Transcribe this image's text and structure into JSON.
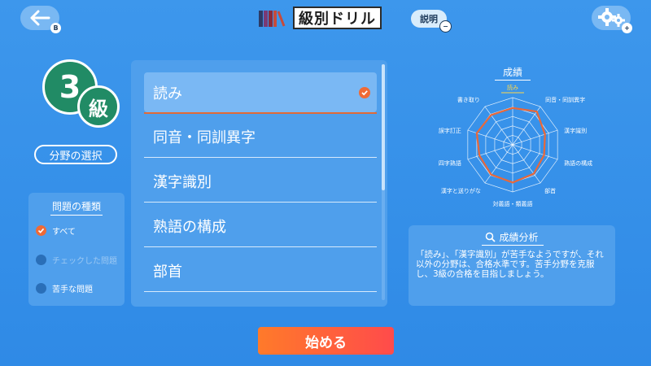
{
  "header": {
    "back_badge": "B",
    "title": "級別ドリル",
    "help_label": "説明",
    "help_badge": "−",
    "settings_badge": "+"
  },
  "level": {
    "number": "3",
    "unit": "級"
  },
  "category_button": "分野の選択",
  "question_types": {
    "title": "問題の種類",
    "options": [
      {
        "label": "すべて",
        "selected": true
      },
      {
        "label": "チェックした問題",
        "selected": false
      },
      {
        "label": "苦手な問題",
        "selected": false
      }
    ]
  },
  "categories": [
    {
      "label": "読み",
      "selected": true
    },
    {
      "label": "同音・同訓異字",
      "selected": false
    },
    {
      "label": "漢字識別",
      "selected": false
    },
    {
      "label": "熟語の構成",
      "selected": false
    },
    {
      "label": "部首",
      "selected": false
    }
  ],
  "radar": {
    "title": "成績",
    "highlight_label": "読み",
    "labels": [
      "読み",
      "同音・同訓異字",
      "漢字識別",
      "熟語の構成",
      "部首",
      "対義語・類義語",
      "漢字と送りがな",
      "四字熟語",
      "誤字訂正",
      "書き取り"
    ],
    "scores": [
      0.78,
      0.87,
      0.72,
      0.7,
      0.76,
      0.8,
      0.78,
      0.74,
      0.8,
      0.78
    ],
    "colors": {
      "score": "#e8683a",
      "grid": "#ffffff",
      "highlight": "#ffd84a"
    }
  },
  "analysis": {
    "title": "成績分析",
    "text": "「読み」、「漢字識別」が苦手なようですが、それ以外の分野は、合格水準です。苦手分野を克服し、3級の合格を目指しましょう。"
  },
  "start_button": "始める",
  "colors": {
    "background": "#3490ea",
    "panel": "#4f9fec",
    "accent": "#ef6a36",
    "level_green": "#218b65"
  }
}
